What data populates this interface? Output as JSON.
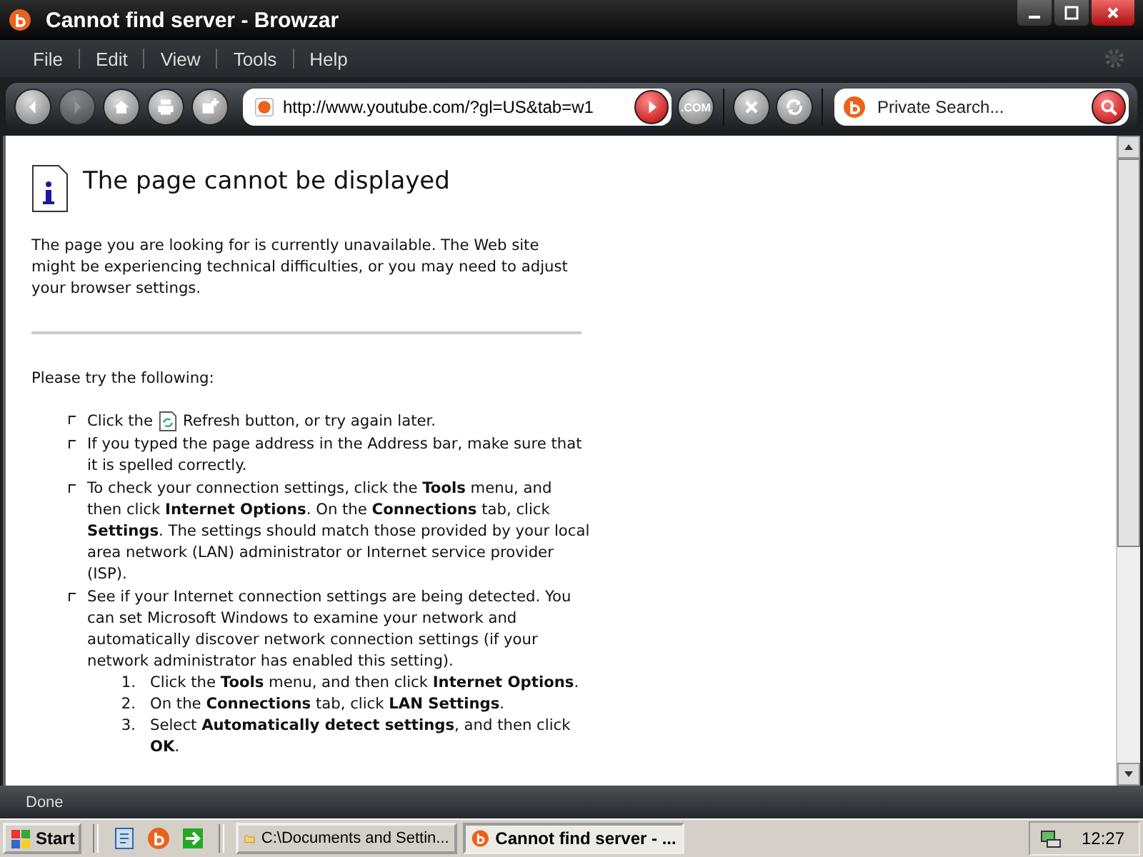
{
  "window": {
    "title": "Cannot find server - Browzar"
  },
  "menu": [
    "File",
    "Edit",
    "View",
    "Tools",
    "Help"
  ],
  "nav_buttons": [
    {
      "kind": "back",
      "disabled": false
    },
    {
      "kind": "forward",
      "disabled": true
    },
    {
      "kind": "home",
      "disabled": false
    },
    {
      "kind": "print",
      "disabled": false
    },
    {
      "kind": "new-tab",
      "disabled": false
    }
  ],
  "address": {
    "value": "http://www.youtube.com/?gl=US&tab=w1"
  },
  "com_button": ".COM",
  "search": {
    "placeholder": "Private Search..."
  },
  "page": {
    "heading": "The page cannot be displayed",
    "intro": "The page you are looking for is currently unavailable. The Web site might be experiencing technical difficulties, or you may need to adjust your browser settings.",
    "try_heading": "Please try the following:",
    "items": [
      {
        "kind": "refresh",
        "before": "Click the",
        "after": "Refresh button, or try again later."
      },
      {
        "kind": "text",
        "text": "If you typed the page address in the Address bar, make sure that it is spelled correctly."
      },
      {
        "kind": "text",
        "text": "To check your connection settings, click the **Tools** menu, and then click **Internet Options**. On the **Connections** tab, click **Settings**. The settings should match those provided by your local area network (LAN) administrator or Internet service provider (ISP)."
      },
      {
        "kind": "steps",
        "text": "See if your Internet connection settings are being detected. You can set Microsoft Windows to examine your network and automatically discover network connection settings (if your network administrator has enabled this setting).",
        "steps": [
          {
            "number": "1.",
            "text": "Click the **Tools** menu, and then click **Internet Options**."
          },
          {
            "number": "2.",
            "text": "On the **Connections** tab, click **LAN Settings**."
          },
          {
            "number": "3.",
            "text": "Select **Automatically detect settings**, and then click **OK**."
          }
        ]
      }
    ]
  },
  "status_bar": {
    "text": "Done"
  },
  "taskbar": {
    "start": "Start",
    "tasks": [
      {
        "kind": "folder",
        "label": "C:\\Documents and Settin...",
        "selected": false
      },
      {
        "kind": "browser",
        "label": "Cannot find server - ...",
        "selected": true
      }
    ],
    "clock": "12:27"
  }
}
